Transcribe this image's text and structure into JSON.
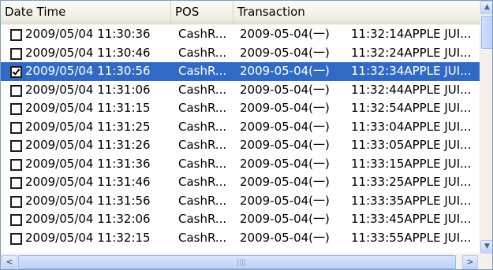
{
  "columns": [
    {
      "label": "Date Time"
    },
    {
      "label": "POS"
    },
    {
      "label": "Transaction"
    }
  ],
  "rows": [
    {
      "checked": false,
      "selected": false,
      "datetime": "2009/05/04 11:30:36",
      "pos": "CashR...",
      "txn_date": "2009-05-04(一)",
      "txn_rest": "11:32:14APPLE JUI..."
    },
    {
      "checked": false,
      "selected": false,
      "datetime": "2009/05/04 11:30:46",
      "pos": "CashR...",
      "txn_date": "2009-05-04(一)",
      "txn_rest": "11:32:24APPLE JUI..."
    },
    {
      "checked": true,
      "selected": true,
      "datetime": "2009/05/04 11:30:56",
      "pos": "CashR...",
      "txn_date": "2009-05-04(一)",
      "txn_rest": "11:32:34APPLE JUI..."
    },
    {
      "checked": false,
      "selected": false,
      "datetime": "2009/05/04 11:31:06",
      "pos": "CashR...",
      "txn_date": "2009-05-04(一)",
      "txn_rest": "11:32:44APPLE JUI..."
    },
    {
      "checked": false,
      "selected": false,
      "datetime": "2009/05/04 11:31:15",
      "pos": "CashR...",
      "txn_date": "2009-05-04(一)",
      "txn_rest": "11:32:54APPLE JUI..."
    },
    {
      "checked": false,
      "selected": false,
      "datetime": "2009/05/04 11:31:25",
      "pos": "CashR...",
      "txn_date": "2009-05-04(一)",
      "txn_rest": "11:33:04APPLE JUI..."
    },
    {
      "checked": false,
      "selected": false,
      "datetime": "2009/05/04 11:31:26",
      "pos": "CashR...",
      "txn_date": "2009-05-04(一)",
      "txn_rest": "11:33:05APPLE JUI..."
    },
    {
      "checked": false,
      "selected": false,
      "datetime": "2009/05/04 11:31:36",
      "pos": "CashR...",
      "txn_date": "2009-05-04(一)",
      "txn_rest": "11:33:15APPLE JUI..."
    },
    {
      "checked": false,
      "selected": false,
      "datetime": "2009/05/04 11:31:46",
      "pos": "CashR...",
      "txn_date": "2009-05-04(一)",
      "txn_rest": "11:33:25APPLE JUI..."
    },
    {
      "checked": false,
      "selected": false,
      "datetime": "2009/05/04 11:31:56",
      "pos": "CashR...",
      "txn_date": "2009-05-04(一)",
      "txn_rest": "11:33:35APPLE JUI..."
    },
    {
      "checked": false,
      "selected": false,
      "datetime": "2009/05/04 11:32:06",
      "pos": "CashR...",
      "txn_date": "2009-05-04(一)",
      "txn_rest": "11:33:45APPLE JUI..."
    },
    {
      "checked": false,
      "selected": false,
      "datetime": "2009/05/04 11:32:15",
      "pos": "CashR...",
      "txn_date": "2009-05-04(一)",
      "txn_rest": "11:33:55APPLE JUI..."
    }
  ],
  "scrollbar": {
    "up_icon": "scroll-up-arrow-icon",
    "down_icon": "scroll-down-arrow-icon",
    "left_icon": "scroll-left-arrow-icon",
    "right_icon": "scroll-right-arrow-icon",
    "up_glyph": "▲",
    "down_glyph": "▼",
    "left_glyph": "<",
    "right_glyph": ">"
  },
  "colors": {
    "selection": "#316ac5",
    "header_bg": "#f1efe2",
    "scroll_accent": "#c1d3fb"
  }
}
